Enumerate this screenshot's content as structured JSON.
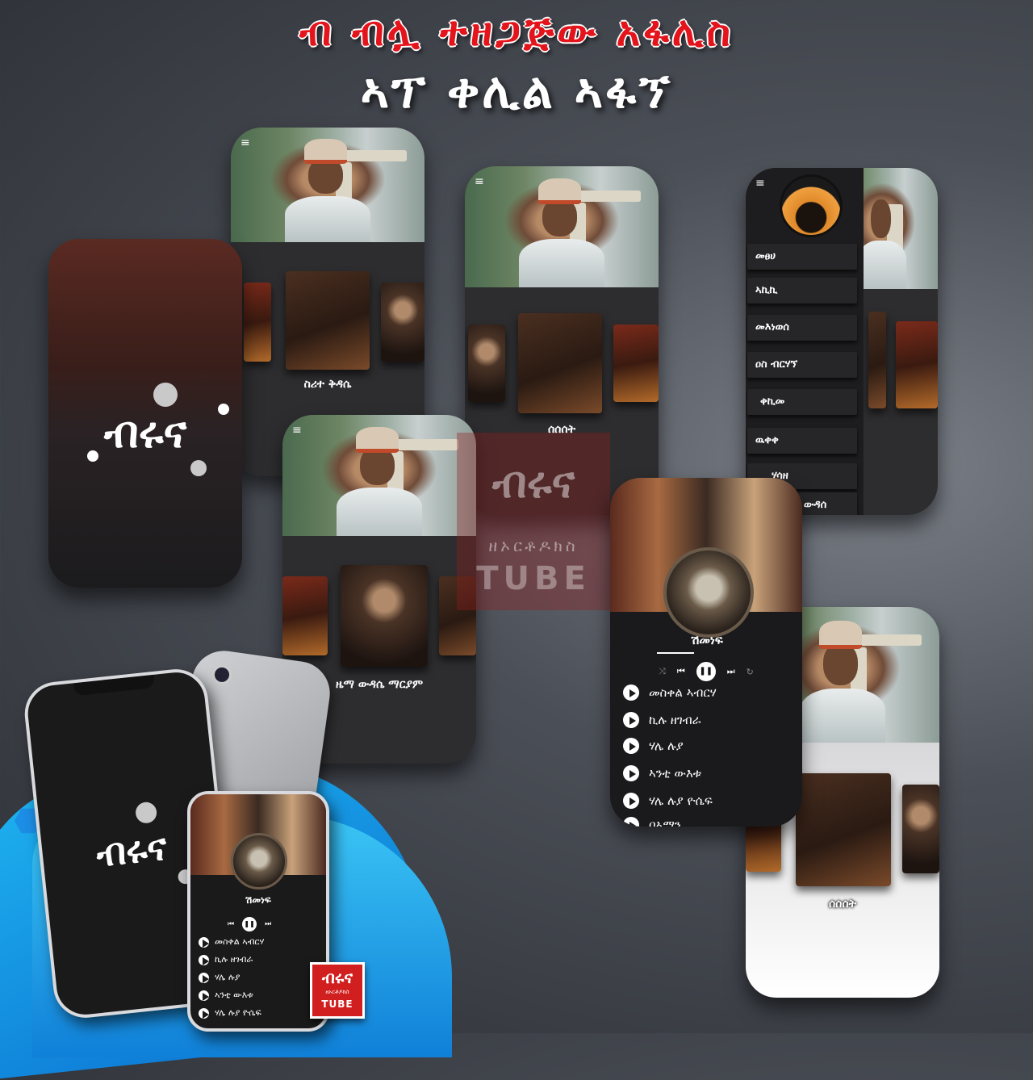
{
  "banner": {
    "line1": "ብ ብሏ ተዘጋጅው አፋሊስ",
    "line2": "ኣፕ ቀሊል ኣፋኘ"
  },
  "splash": {
    "wordmark": "ብሩና"
  },
  "home_screen_1": {
    "menu_icon": "≡",
    "caption": "ስሪተ ቅዳሴ"
  },
  "home_screen_2": {
    "menu_icon": "≡",
    "caption": "ሰሰሰት"
  },
  "home_screen_3": {
    "menu_icon": "≡",
    "caption": "ዜማ ውዳሴ ማርያም"
  },
  "drawer_screen": {
    "menu_icon": "≡",
    "items": [
      "መፀሀ",
      "ኣኪኪ",
      "መእነወሰ",
      "ዐስ ብርሃኘ",
      "ቀኪመ",
      "ዉቀቀ",
      "ሃሳዘ",
      "ውዳሰ"
    ]
  },
  "player_screen": {
    "track_title": "ሽመነፍ",
    "controls": {
      "prev": "⏮",
      "pause": "❚❚",
      "next": "⏭",
      "shuffle": "⤨",
      "repeat": "↻"
    },
    "songs": [
      "መስቀል ኣብርሃ",
      "ኪሉ ዘገብራ",
      "ሃሌ ሉያ",
      "ኣንቲ ውእቱ",
      "ሃሌ ሉያ ዮሴፍ",
      "በኣማን"
    ]
  },
  "light_screen": {
    "caption": "ሰሰሰት"
  },
  "watermark": {
    "mark": "ብሩና",
    "subtitle": "ዘኦርቶዶክስ",
    "word": "TUBE"
  },
  "mockup": {
    "splash_word": "ብሩና",
    "player_title": "ሽመነፍ",
    "songs": [
      "መስቀል ኣብርሃ",
      "ኪሉ ዘገብራ",
      "ሃሌ ሉያ",
      "ኣንቲ ውእቱ",
      "ሃሌ ሉያ ዮሴፍ"
    ]
  },
  "logo_badge": {
    "mark": "ብሩና",
    "subtitle": "ዘኦርቶዶክስ",
    "word": "TUBE"
  },
  "colors": {
    "banner_red": "#e3141b",
    "accent_blue": "#1fb4f0",
    "card_dark": "#2d2d2f"
  }
}
